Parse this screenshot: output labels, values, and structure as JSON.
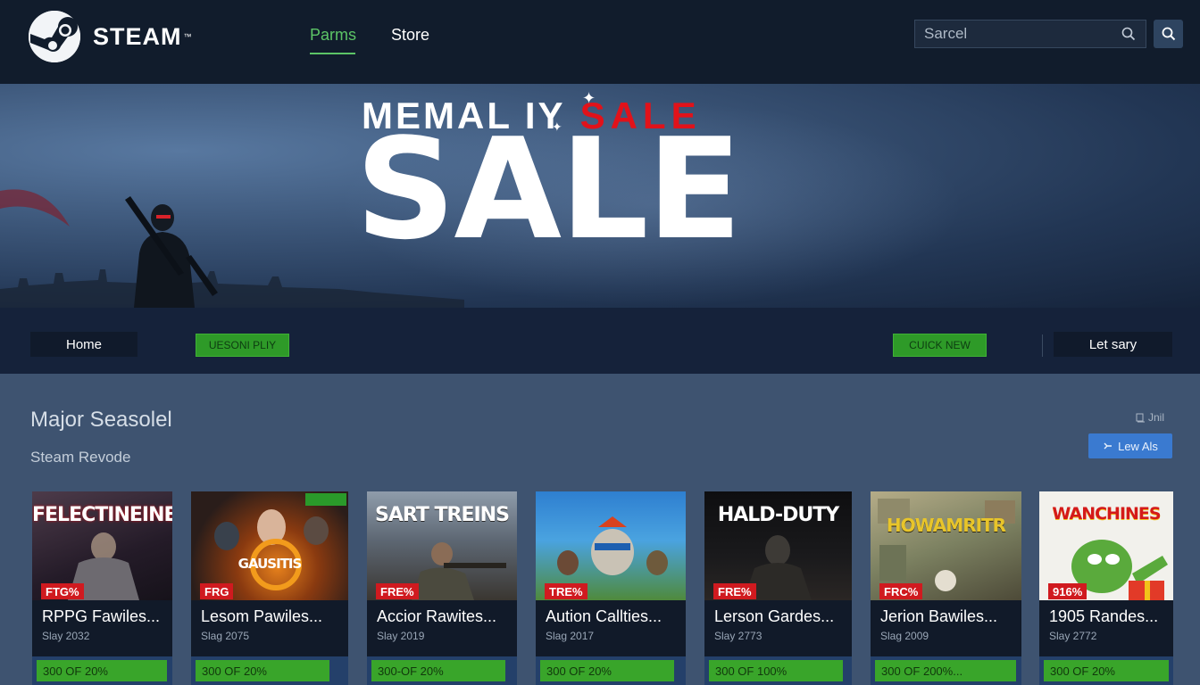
{
  "header": {
    "brand": "STEAM",
    "brand_tm": "™",
    "nav": [
      {
        "label": "Parms",
        "active": true
      },
      {
        "label": "Store",
        "active": false
      }
    ],
    "search": {
      "placeholder": "Sarcel"
    }
  },
  "hero": {
    "line1_white": "MEMAL",
    "line1_mid": "IY",
    "line1_red": "SALE",
    "big_text": "SALE"
  },
  "subnav": {
    "home": "Home",
    "green_1": "UESONI PLIY",
    "green_2": "CUICK NEW",
    "latest": "Let sary"
  },
  "section": {
    "title": "Major Seasolel",
    "subtitle": "Steam Revode",
    "mini_link": "Jnil",
    "view_all": "Lew Als"
  },
  "cards": [
    {
      "art_title": "FELECTINEINE",
      "badge": "FTG%",
      "title": "RPPG Fawiles...",
      "date": "Slay 2032",
      "price": "300 OF 20%"
    },
    {
      "art_title": "GAUSITIS",
      "badge": "FRG",
      "title": "Lesom Pawiles...",
      "date": "Slag 2075",
      "price": "300 OF 20%"
    },
    {
      "art_title": "SART TREINS",
      "badge": "FRE%",
      "title": "Accior Rawites...",
      "date": "Slay 2019",
      "price": "300-OF 20%"
    },
    {
      "art_title": "",
      "badge": "TRE%",
      "title": "Aution Callties...",
      "date": "Slag 2017",
      "price": "300 OF 20%"
    },
    {
      "art_title": "HALD-DUTY",
      "badge": "FRE%",
      "title": "Lerson Gardes...",
      "date": "Slay 2773",
      "price": "300 OF 100%"
    },
    {
      "art_title": "HOWAMRITR",
      "badge": "FRC%",
      "title": "Jerion Bawiles...",
      "date": "Slag 2009",
      "price": "300 OF 200%..."
    },
    {
      "art_title": "WANCHINES",
      "badge": "916%",
      "title": "1905 Randes...",
      "date": "Slay 2772",
      "price": "300 OF 20%"
    }
  ],
  "colors": {
    "header_bg": "#111c2c",
    "accent_green": "#5cc466",
    "sale_red": "#e1121a",
    "button_blue": "#3a7ad0",
    "price_green": "#39a52a"
  }
}
